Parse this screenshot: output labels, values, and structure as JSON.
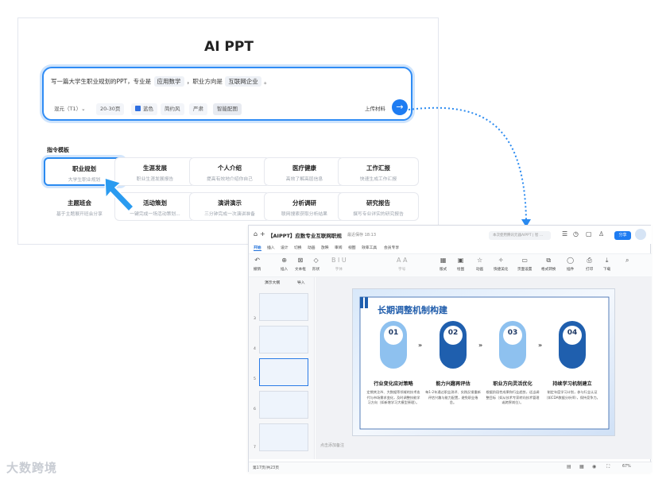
{
  "app": {
    "title": "AI PPT"
  },
  "prompt": {
    "text_before": "写一篇大学生职业规划的PPT，专业是",
    "major": "应用数学",
    "text_middle": "，职业方向是",
    "direction": "互联网企业",
    "text_after": "。"
  },
  "options": {
    "model": "混元（T1）⌄",
    "pages": "20-30页",
    "color": "蓝色",
    "style": "简约风",
    "tone": "严肃",
    "smart_image": "智能配图",
    "upload": "上传材料"
  },
  "templates": {
    "label": "指令模板",
    "items": [
      {
        "title": "职业规划",
        "sub": "大学生职业规划"
      },
      {
        "title": "生涯发展",
        "sub": "职业生涯发展报告"
      },
      {
        "title": "个人介绍",
        "sub": "提高有效地介绍你自己"
      },
      {
        "title": "医疗健康",
        "sub": "高效了解高层信息"
      },
      {
        "title": "工作汇报",
        "sub": "快速生成工作汇报"
      },
      {
        "title": "主题班会",
        "sub": "基于主题展开班会分享"
      },
      {
        "title": "活动策划",
        "sub": "一键完成一场活动策划..."
      },
      {
        "title": "演讲演示",
        "sub": "三分钟完成一次演讲准备"
      },
      {
        "title": "分析调研",
        "sub": "联网搜索获取分析结果"
      },
      {
        "title": "研究报告",
        "sub": "撰写专业详实的研究报告"
      }
    ]
  },
  "editor": {
    "doc_title": "【AIPPT】应数专业互联网职规",
    "autosave": "最近保存 18:13",
    "search_placeholder": "本次使用腾讯元器AIPPT | 智 ...",
    "share": "分享",
    "menus": [
      "开始",
      "插入",
      "设计",
      "切换",
      "动画",
      "放映",
      "审阅",
      "视图",
      "效率工具",
      "会员专享"
    ],
    "ribbon": [
      {
        "icon": "undo",
        "label": "撤销"
      },
      {
        "icon": "new-slide",
        "label": "插入"
      },
      {
        "icon": "textbox",
        "label": "文本框"
      },
      {
        "icon": "shape",
        "label": "形状"
      },
      {
        "icon": "font",
        "label": "字体"
      },
      {
        "icon": "size",
        "label": "字号"
      },
      {
        "icon": "layout",
        "label": "版式"
      },
      {
        "icon": "picture",
        "label": "绘图"
      },
      {
        "icon": "animation",
        "label": "动画"
      },
      {
        "icon": "smart",
        "label": "快捷美化"
      },
      {
        "icon": "page-setup",
        "label": "页面设置"
      },
      {
        "icon": "format",
        "label": "格式转换"
      },
      {
        "icon": "plugin",
        "label": "插件"
      },
      {
        "icon": "print",
        "label": "打印"
      },
      {
        "icon": "download",
        "label": "下载"
      }
    ],
    "panel_tabs": [
      "演示大纲",
      "导入"
    ],
    "slide_numbers": [
      "3",
      "4",
      "5",
      "6",
      "7"
    ],
    "notes_placeholder": "点击添加备注",
    "status_pages": "第17页/共23页",
    "zoom": "67%"
  },
  "slide": {
    "title": "长期调整机制构建",
    "steps": [
      {
        "num": "01",
        "title": "行业变化应对策略",
        "desc": "定期关注AI、大数据等领域的技术迭代与市场需求变化，及时调整技能学习方向（如新增学习大模型原理）。"
      },
      {
        "num": "02",
        "title": "能力兴趣再评估",
        "desc": "每1-2年通过职业测评、实践反馈重新评估兴趣与能力配置，避免职业倦怠。"
      },
      {
        "num": "03",
        "title": "职业方向灵活优化",
        "desc": "根据阶段性成果和行业趋势，适当调整目标（如从技术专家转向技术管理或跨界岗位）。"
      },
      {
        "num": "04",
        "title": "持续学习机制建立",
        "desc": "制定年度学习计划，参与行业认证（如CDA数据分析师），保持竞争力。"
      }
    ],
    "colors": {
      "light": "#8ec1ef",
      "dark": "#1f5fae"
    }
  },
  "watermark": "大数跨境"
}
